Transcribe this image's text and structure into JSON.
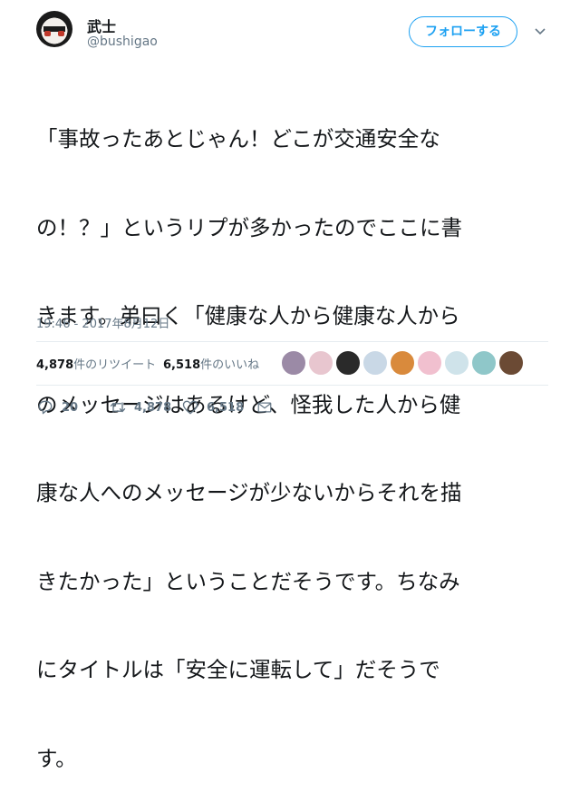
{
  "user": {
    "display_name": "武士",
    "handle": "@bushigao"
  },
  "follow_button": {
    "label": "フォローする"
  },
  "tweet": {
    "lines": [
      "「事故ったあとじゃん！どこが交通安全な",
      "の！？」というリプが多かったのでここに書",
      "きます。弟曰く「健康な人から健康な人から",
      "のメッセージはあるけど、怪我した人から健",
      "康な人へのメッセージが少ないからそれを描",
      "きたかった」ということだそうです。ちなみ",
      "にタイトルは「安全に運転して」だそうで",
      "す。"
    ],
    "timestamp": "19:46 - 2017年8月12日"
  },
  "stats": {
    "retweets_count": "4,878",
    "retweets_label": "件のリツイート",
    "likes_count": "6,518",
    "likes_label": "件のいいね"
  },
  "likers": {
    "icon": "liker-avatar",
    "colors": [
      "#9b8aa6",
      "#e8c6cf",
      "#2a2a2a",
      "#c9d8e6",
      "#d98a3c",
      "#f1c0cf",
      "#cfe3ea",
      "#8fc7c9",
      "#6b4a34"
    ]
  },
  "actions": {
    "reply": {
      "icon": "reply-icon",
      "count": "20"
    },
    "retweet": {
      "icon": "retweet-icon",
      "count": "4,878"
    },
    "like": {
      "icon": "heart-icon",
      "count": "6,518"
    },
    "message": {
      "icon": "envelope-icon"
    }
  },
  "colors": {
    "accent": "#1da1f2",
    "secondary_text": "#657786",
    "primary_text": "#14171a",
    "divider": "#e6ecf0"
  }
}
